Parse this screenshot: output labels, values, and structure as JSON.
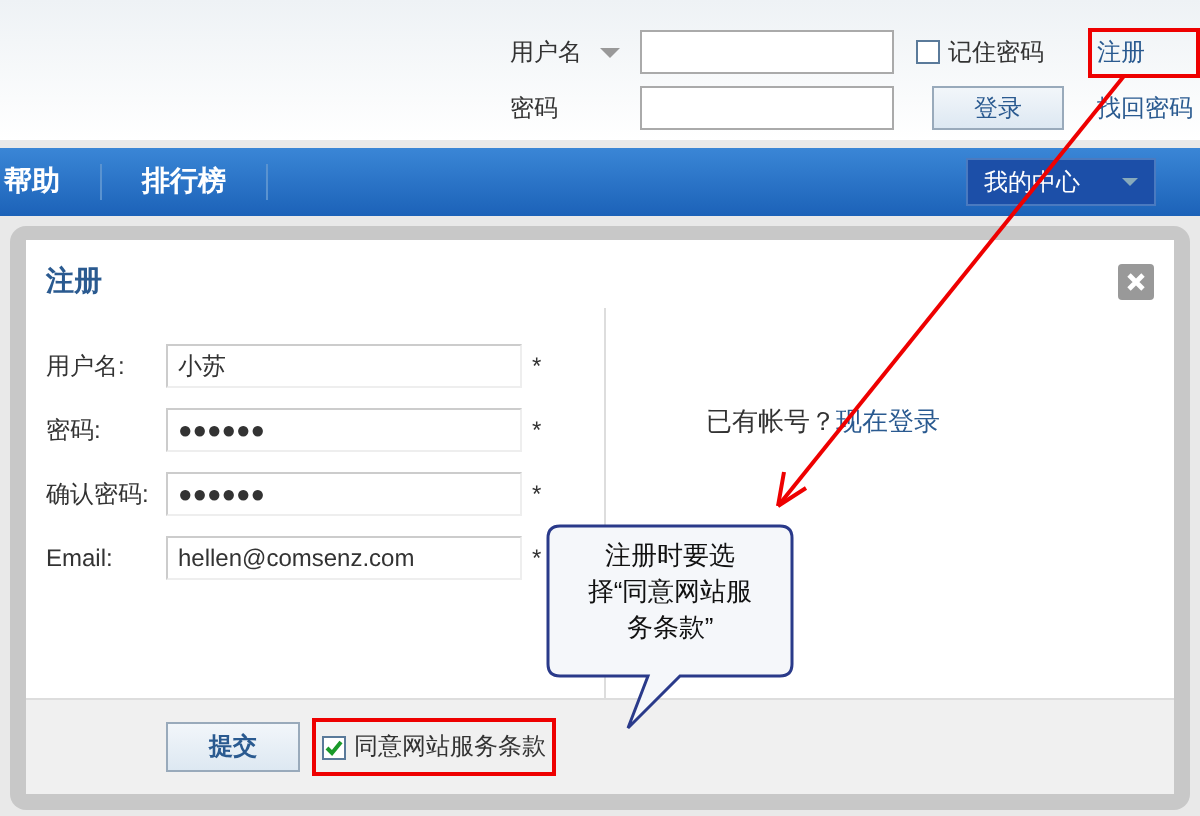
{
  "header": {
    "username_label": "用户名",
    "password_label": "密码",
    "remember": {
      "label": "记住密码",
      "checked": false
    },
    "register_link": "注册",
    "login_button": "登录",
    "forgot_link": "找回密码"
  },
  "nav": {
    "items": [
      "帮助",
      "排行榜"
    ],
    "my_center": "我的中心"
  },
  "dialog": {
    "title": "注册",
    "fields": [
      {
        "label": "用户名:",
        "value": "小苏",
        "required": "*"
      },
      {
        "label": "密码:",
        "value": "●●●●●●",
        "required": "*"
      },
      {
        "label": "确认密码:",
        "value": "●●●●●●",
        "required": "*"
      },
      {
        "label": "Email:",
        "value": "hellen@comsenz.com",
        "required": "*"
      }
    ],
    "has_account": "已有帐号？",
    "login_link": "现在登录",
    "submit": "提交",
    "agree": {
      "label": "同意网站服务条款",
      "checked": true
    }
  },
  "callout": {
    "text": "注册时要选择“同意网站服务条款”"
  }
}
